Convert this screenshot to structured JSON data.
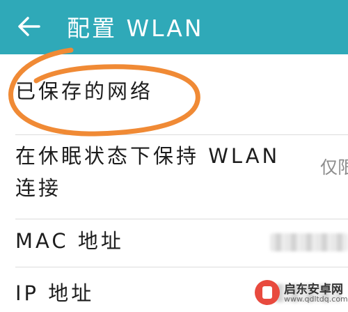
{
  "header": {
    "back_icon": "arrow-left-icon",
    "title": "配置 WLAN",
    "background_color": "#2fa9b8"
  },
  "settings": {
    "saved_networks": "已保存的网络",
    "sleep_keep_wlan": "在休眠状态下保持 WLAN 连接",
    "sleep_keep_wlan_value": "仅限",
    "mac_address": "MAC 地址",
    "ip_address": "IP 地址"
  },
  "annotation": {
    "type": "hand-drawn circle",
    "color": "#f08a35",
    "target": "已保存的网络"
  },
  "watermark": {
    "name": "启东安卓网",
    "url": "www.qdltdq.com"
  }
}
